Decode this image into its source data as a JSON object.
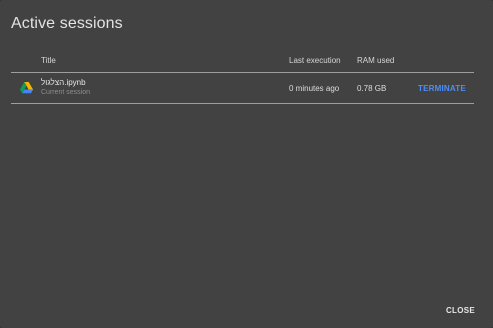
{
  "dialog": {
    "title": "Active sessions",
    "close_label": "CLOSE"
  },
  "table": {
    "headers": {
      "title": "Title",
      "last_execution": "Last execution",
      "ram_used": "RAM used"
    },
    "rows": [
      {
        "icon": "google-drive-icon",
        "file_name": "הצלגול.ipynb",
        "subtitle": "Current session",
        "last_execution": "0 minutes ago",
        "ram_used": "0.78 GB",
        "action_label": "TERMINATE"
      }
    ]
  },
  "colors": {
    "dialog_bg": "#424242",
    "accent": "#4e8ef7",
    "divider": "#9e9e9e",
    "drive_green": "#0f9d58",
    "drive_yellow": "#f4b400",
    "drive_blue": "#4285f4"
  }
}
